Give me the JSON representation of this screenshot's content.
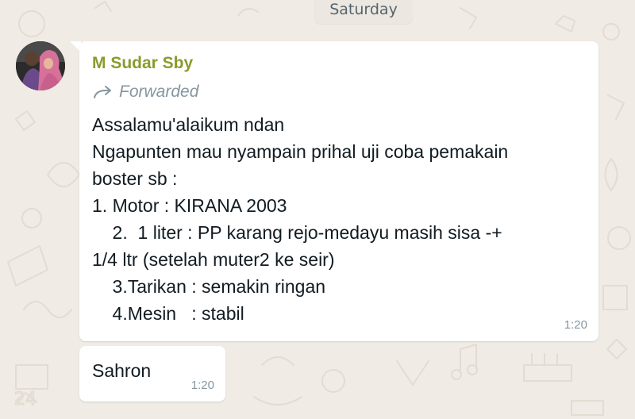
{
  "chat": {
    "day_divider": "Saturday",
    "messages": [
      {
        "sender": "M Sudar Sby",
        "forwarded_label": "Forwarded",
        "lines": [
          "Assalamu'alaikum ndan",
          "Ngapunten mau nyampain prihal uji coba pemakain",
          "boster sb :",
          "1. Motor : KIRANA 2003",
          "    2.  1 liter : PP karang rejo-medayu masih sisa -+",
          "1/4 ltr (setelah muter2 ke seir)",
          "    3.Tarikan : semakin ringan",
          "    4.Mesin   : stabil"
        ],
        "time": "1:20"
      },
      {
        "text": "Sahron",
        "time": "1:20"
      }
    ]
  },
  "colors": {
    "background": "#f0ebe4",
    "bubble": "#ffffff",
    "sender_name": "#8c9a2c",
    "meta_text": "#8696a0",
    "message_text": "#111b21"
  },
  "icons": {
    "forward": "forward-arrow-icon",
    "avatar": "contact-avatar"
  }
}
